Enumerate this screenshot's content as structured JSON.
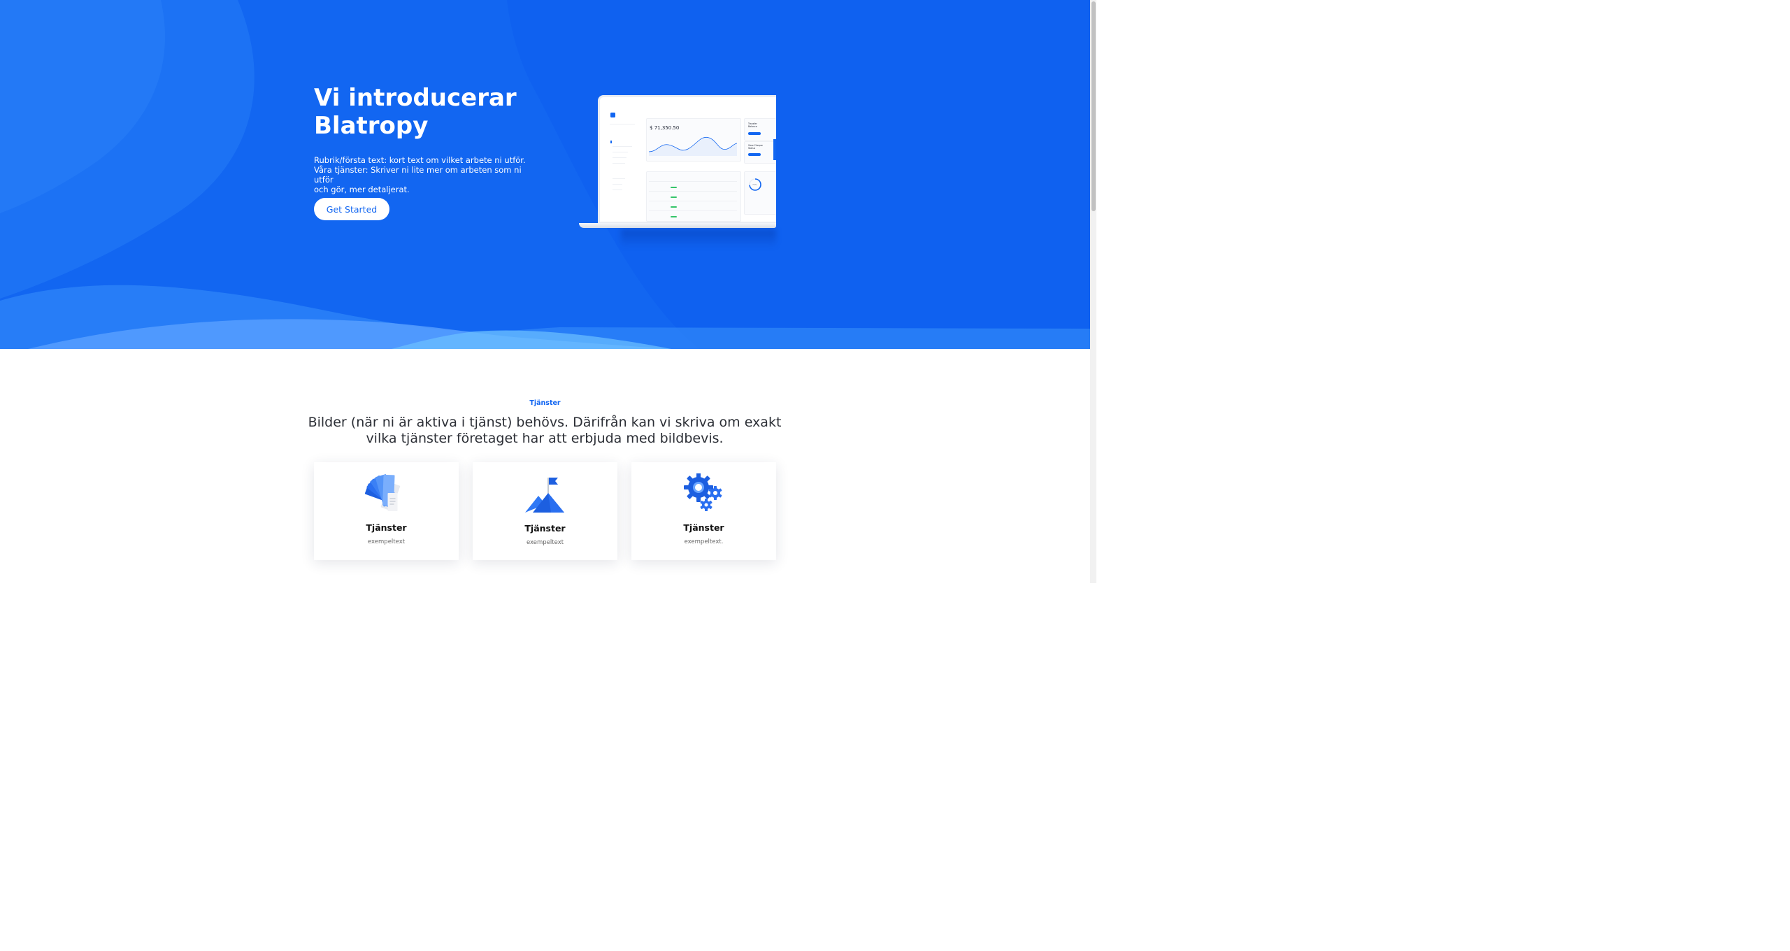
{
  "hero": {
    "title_line1": "Vi introducerar",
    "title_line2": "Blatropy",
    "text_line1": "Rubrik/första text: kort text om vilket arbete ni utför.",
    "text_line2": "Våra tjänster: Skriver ni lite mer om arbeten som ni utför",
    "text_line3": "och gör, mer detaljerat.",
    "cta_label": "Get Started",
    "background_color": "#1266f1"
  },
  "dashboard_preview": {
    "balance": "71,350.50",
    "currency": "$",
    "transfer_title_line1": "Transfer",
    "transfer_title_line2": "Balance",
    "cheque_title_line1": "View Cheque",
    "cheque_title_line2": "Status",
    "progress_label": "73%",
    "progress_value": 0.73
  },
  "services": {
    "eyebrow": "Tjänster",
    "title_line1": "Bilder (när ni är aktiva i tjänst) behövs. Därifrån kan vi skriva om exakt",
    "title_line2": "vilka tjänster företaget har att erbjuda med bildbevis.",
    "cards": [
      {
        "title": "Tjänster",
        "text": "exempeltext",
        "icon": "color-swatch-icon"
      },
      {
        "title": "Tjänster",
        "text": "exempeltext",
        "icon": "mountain-flag-icon"
      },
      {
        "title": "Tjänster",
        "text": "exempeltext.",
        "icon": "gears-icon"
      }
    ]
  },
  "colors": {
    "accent": "#1266f1",
    "light_blue": "#5aa9ff",
    "white": "#ffffff"
  }
}
